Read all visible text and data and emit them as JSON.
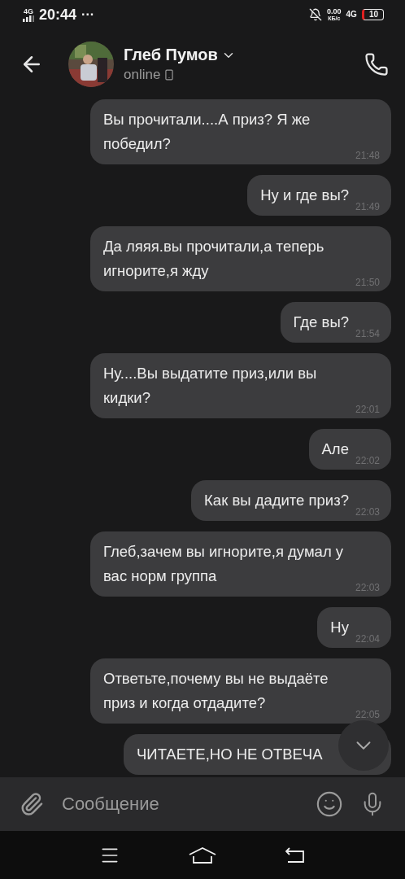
{
  "status_bar": {
    "network": "4G",
    "time": "20:44",
    "more": "···",
    "speed": "0.00",
    "speed_unit": "КБ/с",
    "network_2": "4G",
    "battery": "10"
  },
  "header": {
    "name": "Глеб Пумов",
    "status": "online"
  },
  "messages": [
    {
      "text": "Вы прочитали....А приз? Я же победил?",
      "time": "21:48"
    },
    {
      "text": "Ну и где вы?",
      "time": "21:49"
    },
    {
      "text": "Да ляяя.вы прочитали,а  теперь игнорите,я жду",
      "time": "21:50"
    },
    {
      "text": "Где вы?",
      "time": "21:54"
    },
    {
      "text": "Ну....Вы выдатите приз,или вы кидки?",
      "time": "22:01"
    },
    {
      "text": "Але",
      "time": "22:02"
    },
    {
      "text": "Как вы дадите приз?",
      "time": "22:03"
    },
    {
      "text": "Глеб,зачем вы игнорите,я думал у вас  норм группа",
      "time": "22:03"
    },
    {
      "text": "Ну",
      "time": "22:04"
    },
    {
      "text": "Ответьте,почему вы не выдаёте приз и когда отдадите?",
      "time": "22:05"
    },
    {
      "text": "ЧИТАЕТЕ,НО НЕ ОТВЕЧА"
    }
  ],
  "composer": {
    "placeholder": "Сообщение"
  }
}
